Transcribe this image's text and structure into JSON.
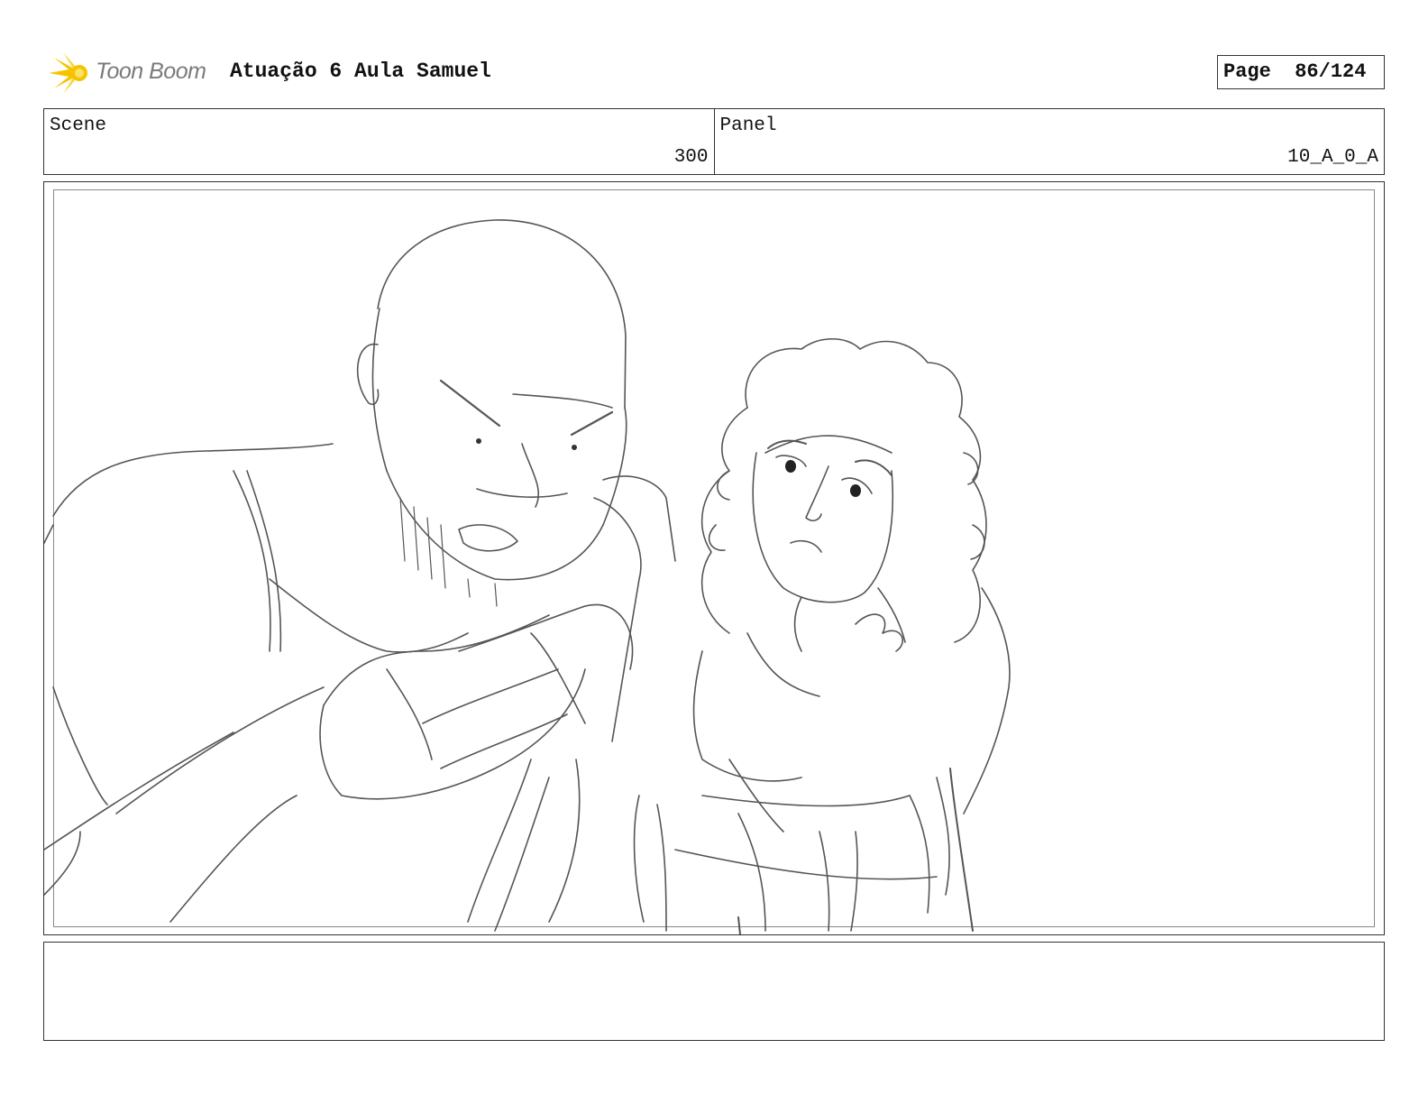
{
  "header": {
    "logo_text": "Toon Boom",
    "title": "Atuação 6 Aula Samuel",
    "page_label": "Page",
    "page_value": "86/124"
  },
  "info": {
    "scene_label": "Scene",
    "scene_value": "300",
    "panel_label": "Panel",
    "panel_value": "10_A_0_A"
  },
  "notes": {
    "text": ""
  },
  "colors": {
    "logo_accent": "#f5c400",
    "sketch_line": "#555555"
  }
}
